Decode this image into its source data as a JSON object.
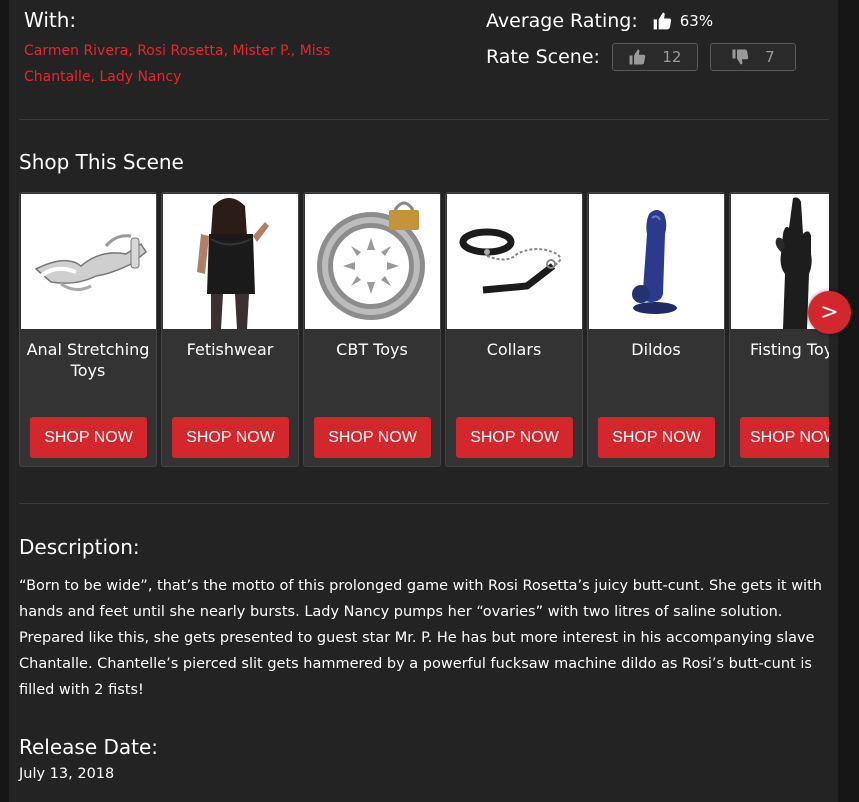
{
  "with": {
    "label": "With:",
    "names": "Carmen Rivera, Rosi Rosetta, Mister P., Miss Chantalle, Lady Nancy"
  },
  "rating": {
    "average_label": "Average Rating:",
    "average_value": "63%",
    "rate_label": "Rate Scene:",
    "likes": "12",
    "dislikes": "7"
  },
  "shop": {
    "title": "Shop This Scene",
    "next_label": ">",
    "items": [
      {
        "name": "Anal Stretching Toys",
        "button": "SHOP NOW",
        "icon": "speculum-image"
      },
      {
        "name": "Fetishwear",
        "button": "SHOP NOW",
        "icon": "lingerie-model-image"
      },
      {
        "name": "CBT Toys",
        "button": "SHOP NOW",
        "icon": "spiked-ring-image"
      },
      {
        "name": "Collars",
        "button": "SHOP NOW",
        "icon": "collar-leash-image"
      },
      {
        "name": "Dildos",
        "button": "SHOP NOW",
        "icon": "blue-dildo-image"
      },
      {
        "name": "Fisting Toys",
        "button": "SHOP NOW",
        "icon": "hand-image"
      }
    ]
  },
  "description": {
    "title": "Description:",
    "text": "“Born to be wide”, that’s the motto of this prolonged game with Rosi Rosetta’s juicy butt-cunt. She gets it with hands and feet until she nearly bursts. Lady Nancy pumps her “ovaries” with two litres of saline solution. Prepared like this, she gets presented to guest star Mr. P. He has but more interest in his accompanying slave Chantalle. Chantelle’s pierced slit gets hammered by a powerful fucksaw machine dildo as Rosi’s butt-cunt is filled with 2 fists!"
  },
  "release": {
    "title": "Release Date:",
    "date": "July 13, 2018"
  },
  "colors": {
    "accent": "#d3272d",
    "link": "#e8262c",
    "background": "#232323"
  }
}
